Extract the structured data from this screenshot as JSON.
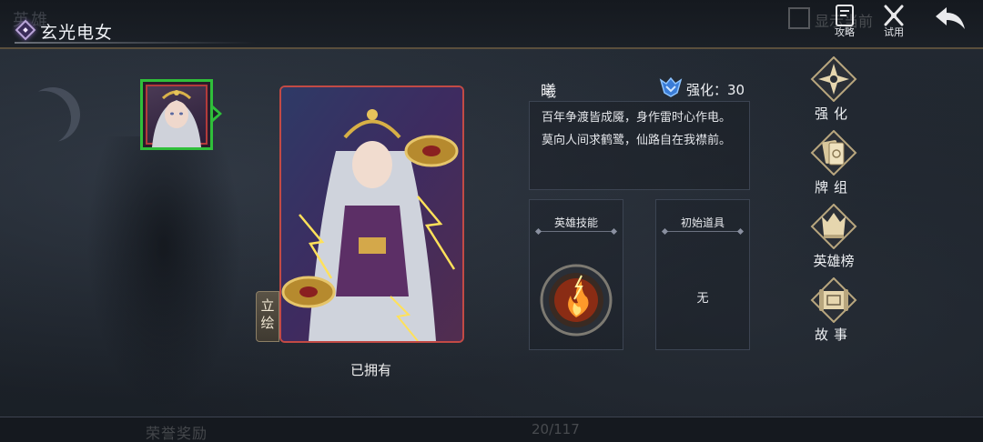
{
  "header": {
    "background_title": "英雄",
    "title": "玄光电女",
    "background_checkbox_label": "显示当前",
    "buttons": [
      {
        "label": "攻略",
        "icon": "guide-book-icon"
      },
      {
        "label": "试用",
        "icon": "trial-swords-icon"
      }
    ],
    "back_icon": "back-arrow-icon"
  },
  "card": {
    "side_tab": "立绘",
    "status": "已拥有"
  },
  "info": {
    "name": "曦",
    "enhance_label": "强化：30",
    "description": [
      "百年争渡皆成魇，身作雷时心作电。",
      "莫向人间求鹤鹭，仙路自在我襟前。"
    ],
    "skill_panel": {
      "title": "英雄技能",
      "icon": "lightning-fire-skill-icon"
    },
    "item_panel": {
      "title": "初始道具",
      "value": "无"
    }
  },
  "menu": [
    {
      "label": "强化",
      "icon": "compass-star-icon"
    },
    {
      "label": "牌组",
      "icon": "card-deck-icon"
    },
    {
      "label": "英雄榜",
      "icon": "hero-ranking-icon"
    },
    {
      "label": "故事",
      "icon": "story-scroll-icon"
    }
  ],
  "footer": {
    "background_reward": "荣誉奖励",
    "background_counter": "20/117"
  },
  "colors": {
    "selection_green": "#2fbf3a",
    "card_border_red": "#c24a45",
    "gold_accent": "#c9b38a"
  }
}
